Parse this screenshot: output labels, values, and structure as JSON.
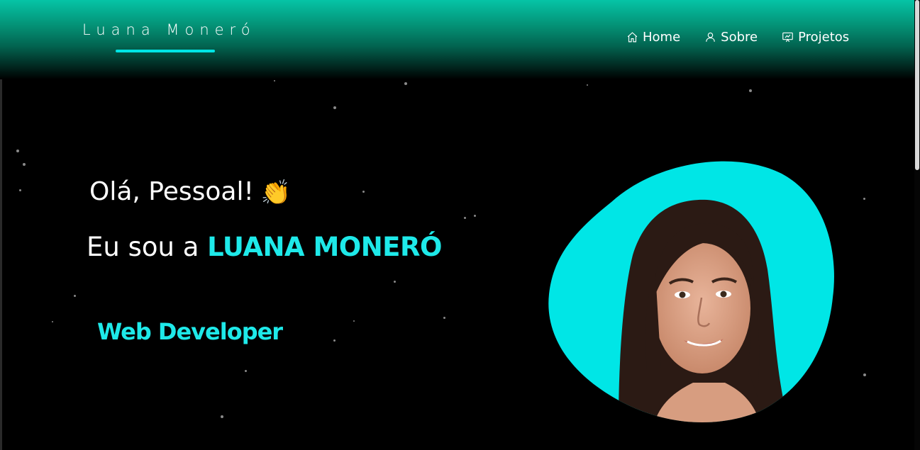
{
  "header": {
    "brand": "Luana Moneró",
    "nav": [
      {
        "label": "Home",
        "icon": "home-icon"
      },
      {
        "label": "Sobre",
        "icon": "user-icon"
      },
      {
        "label": "Projetos",
        "icon": "projects-icon"
      }
    ]
  },
  "hero": {
    "greeting": "Olá, Pessoal!",
    "wave_emoji": "👏",
    "intro_prefix": "Eu sou a ",
    "name": "LUANA MONERÓ",
    "role": "Web Developer"
  },
  "colors": {
    "accent": "#1ee9e9",
    "header_gradient_top": "#05c4a6",
    "blob": "#00e6e6",
    "background": "#000000"
  }
}
